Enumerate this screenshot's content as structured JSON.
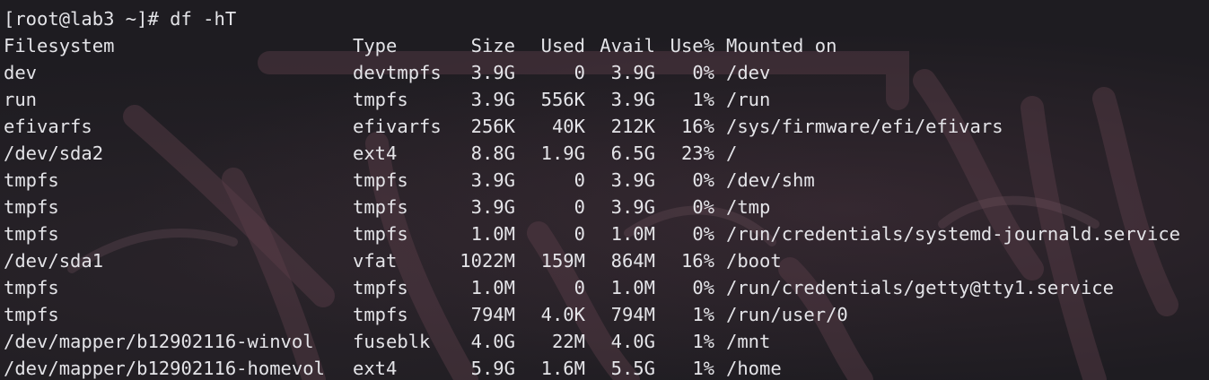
{
  "prompt": {
    "text": "[root@lab3 ~]# df -hT"
  },
  "table": {
    "headers": {
      "filesystem": "Filesystem",
      "type": "Type",
      "size": "Size",
      "used": "Used",
      "avail": "Avail",
      "use_pct": "Use%",
      "mounted_on": "Mounted on"
    },
    "rows": [
      {
        "filesystem": "dev",
        "type": "devtmpfs",
        "size": "3.9G",
        "used": "0",
        "avail": "3.9G",
        "use_pct": "0%",
        "mounted_on": "/dev"
      },
      {
        "filesystem": "run",
        "type": "tmpfs",
        "size": "3.9G",
        "used": "556K",
        "avail": "3.9G",
        "use_pct": "1%",
        "mounted_on": "/run"
      },
      {
        "filesystem": "efivarfs",
        "type": "efivarfs",
        "size": "256K",
        "used": "40K",
        "avail": "212K",
        "use_pct": "16%",
        "mounted_on": "/sys/firmware/efi/efivars"
      },
      {
        "filesystem": "/dev/sda2",
        "type": "ext4",
        "size": "8.8G",
        "used": "1.9G",
        "avail": "6.5G",
        "use_pct": "23%",
        "mounted_on": "/"
      },
      {
        "filesystem": "tmpfs",
        "type": "tmpfs",
        "size": "3.9G",
        "used": "0",
        "avail": "3.9G",
        "use_pct": "0%",
        "mounted_on": "/dev/shm"
      },
      {
        "filesystem": "tmpfs",
        "type": "tmpfs",
        "size": "3.9G",
        "used": "0",
        "avail": "3.9G",
        "use_pct": "0%",
        "mounted_on": "/tmp"
      },
      {
        "filesystem": "tmpfs",
        "type": "tmpfs",
        "size": "1.0M",
        "used": "0",
        "avail": "1.0M",
        "use_pct": "0%",
        "mounted_on": "/run/credentials/systemd-journald.service"
      },
      {
        "filesystem": "/dev/sda1",
        "type": "vfat",
        "size": "1022M",
        "used": "159M",
        "avail": "864M",
        "use_pct": "16%",
        "mounted_on": "/boot"
      },
      {
        "filesystem": "tmpfs",
        "type": "tmpfs",
        "size": "1.0M",
        "used": "0",
        "avail": "1.0M",
        "use_pct": "0%",
        "mounted_on": "/run/credentials/getty@tty1.service"
      },
      {
        "filesystem": "tmpfs",
        "type": "tmpfs",
        "size": "794M",
        "used": "4.0K",
        "avail": "794M",
        "use_pct": "1%",
        "mounted_on": "/run/user/0"
      },
      {
        "filesystem": "/dev/mapper/b12902116-winvol",
        "type": "fuseblk",
        "size": "4.0G",
        "used": "22M",
        "avail": "4.0G",
        "use_pct": "1%",
        "mounted_on": "/mnt"
      },
      {
        "filesystem": "/dev/mapper/b12902116-homevol",
        "type": "ext4",
        "size": "5.9G",
        "used": "1.6M",
        "avail": "5.5G",
        "use_pct": "1%",
        "mounted_on": "/home"
      }
    ]
  },
  "colors": {
    "background": "#1e1c21",
    "text": "#e4e4e8"
  }
}
